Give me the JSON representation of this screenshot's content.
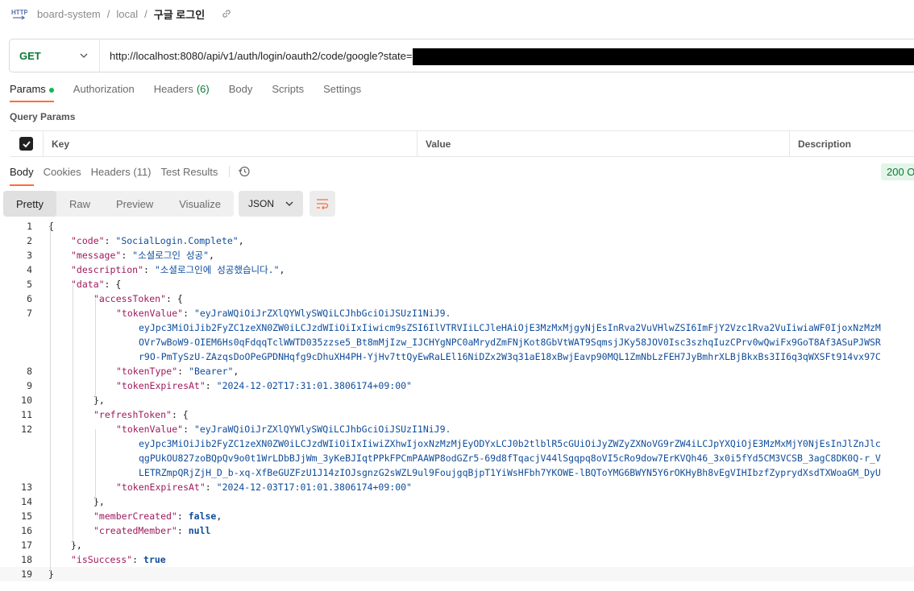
{
  "breadcrumb": {
    "workspace": "board-system",
    "env": "local",
    "current": "구글 로그인"
  },
  "request": {
    "method": "GET",
    "url": "http://localhost:8080/api/v1/auth/login/oauth2/code/google?state="
  },
  "req_tabs": [
    {
      "label": "Params",
      "dot": true
    },
    {
      "label": "Authorization"
    },
    {
      "label": "Headers",
      "count": "(6)"
    },
    {
      "label": "Body"
    },
    {
      "label": "Scripts"
    },
    {
      "label": "Settings"
    }
  ],
  "query_params": {
    "title": "Query Params",
    "headers": [
      "Key",
      "Value",
      "Description"
    ]
  },
  "resp_tabs": [
    "Body",
    "Cookies",
    "Headers (11)",
    "Test Results"
  ],
  "status": "200 O",
  "view_buttons": [
    "Pretty",
    "Raw",
    "Preview",
    "Visualize"
  ],
  "format": "JSON",
  "json_lines": [
    {
      "n": "1",
      "i": 0,
      "t": [
        [
          "p",
          "{"
        ]
      ]
    },
    {
      "n": "2",
      "i": 1,
      "t": [
        [
          "k",
          "\"code\""
        ],
        [
          "p",
          ": "
        ],
        [
          "s",
          "\"SocialLogin.Complete\""
        ],
        [
          "p",
          ","
        ]
      ]
    },
    {
      "n": "3",
      "i": 1,
      "t": [
        [
          "k",
          "\"message\""
        ],
        [
          "p",
          ": "
        ],
        [
          "s",
          "\"소셜로그인 성공\""
        ],
        [
          "p",
          ","
        ]
      ]
    },
    {
      "n": "4",
      "i": 1,
      "t": [
        [
          "k",
          "\"description\""
        ],
        [
          "p",
          ": "
        ],
        [
          "s",
          "\"소셜로그인에 성공했습니다.\""
        ],
        [
          "p",
          ","
        ]
      ]
    },
    {
      "n": "5",
      "i": 1,
      "t": [
        [
          "k",
          "\"data\""
        ],
        [
          "p",
          ": {"
        ]
      ]
    },
    {
      "n": "6",
      "i": 2,
      "t": [
        [
          "k",
          "\"accessToken\""
        ],
        [
          "p",
          ": {"
        ]
      ]
    },
    {
      "n": "7",
      "i": 3,
      "t": [
        [
          "k",
          "\"tokenValue\""
        ],
        [
          "p",
          ": "
        ],
        [
          "s",
          "\"eyJraWQiOiJrZXlQYWlySWQiLCJhbGciOiJSUzI1NiJ9."
        ]
      ]
    },
    {
      "n": "",
      "i": 4,
      "t": [
        [
          "s",
          "eyJpc3MiOiJib2FyZC1zeXN0ZW0iLCJzdWIiOiIxIiwicm9sZSI6IlVTRVIiLCJleHAiOjE3MzMxMjgyNjEsInRva2VuVHlwZSI6ImFjY2Vzc1Rva2VuIiwiaWF0IjoxNzMzM"
        ]
      ]
    },
    {
      "n": "",
      "i": 4,
      "t": [
        [
          "s",
          "OVr7wBoW9-OIEM6Hs0qFdqqTclWWTD035zzse5_Bt8mMjIzw_IJCHYgNPC0aMrydZmFNjKot8GbVtWAT9SqmsjJKy58JOV0Isc3szhqIuzCPrv0wQwiFx9GoT8Af3ASuPJWSR"
        ]
      ]
    },
    {
      "n": "",
      "i": 4,
      "t": [
        [
          "s",
          "r9O-PmTySzU-ZAzqsDoOPeGPDNHqfg9cDhuXH4PH-YjHv7ttQyEwRaLEl16NiDZx2W3q31aE18xBwjEavp90MQL1ZmNbLzFEH7JyBmhrXLBjBkxBs3II6q3qWXSFt914vx97C"
        ]
      ]
    },
    {
      "n": "8",
      "i": 3,
      "t": [
        [
          "k",
          "\"tokenType\""
        ],
        [
          "p",
          ": "
        ],
        [
          "s",
          "\"Bearer\""
        ],
        [
          "p",
          ","
        ]
      ]
    },
    {
      "n": "9",
      "i": 3,
      "t": [
        [
          "k",
          "\"tokenExpiresAt\""
        ],
        [
          "p",
          ": "
        ],
        [
          "s",
          "\"2024-12-02T17:31:01.3806174+09:00\""
        ]
      ]
    },
    {
      "n": "10",
      "i": 2,
      "t": [
        [
          "p",
          "},"
        ]
      ]
    },
    {
      "n": "11",
      "i": 2,
      "t": [
        [
          "k",
          "\"refreshToken\""
        ],
        [
          "p",
          ": {"
        ]
      ]
    },
    {
      "n": "12",
      "i": 3,
      "t": [
        [
          "k",
          "\"tokenValue\""
        ],
        [
          "p",
          ": "
        ],
        [
          "s",
          "\"eyJraWQiOiJrZXlQYWlySWQiLCJhbGciOiJSUzI1NiJ9."
        ]
      ]
    },
    {
      "n": "",
      "i": 4,
      "t": [
        [
          "s",
          "eyJpc3MiOiJib2FyZC1zeXN0ZW0iLCJzdWIiOiIxIiwiZXhwIjoxNzMzMjEyODYxLCJ0b2tlblR5cGUiOiJyZWZyZXNoVG9rZW4iLCJpYXQiOjE3MzMxMjY0NjEsInJlZnJlc"
        ]
      ]
    },
    {
      "n": "",
      "i": 4,
      "t": [
        [
          "s",
          "qgPUkOU827zoBQpQv9o0t1WrLDbBJjWm_3yKeBJIqtPPkFPCmPAAWP8odGZr5-69d8fTqacjV44lSgqpq8oVI5cRo9dow7ErKVQh46_3x0i5fYd5CM3VCSB_3agC8DK0Q-r_V"
        ]
      ]
    },
    {
      "n": "",
      "i": 4,
      "t": [
        [
          "s",
          "LETRZmpQRjZjH_D_b-xq-XfBeGUZFzU1J14zIOJsgnzG2sWZL9ul9FoujgqBjpT1YiWsHFbh7YKOWE-lBQToYMG6BWYN5Y6rOKHyBh8vEgVIHIbzfZyprydXsdTXWoaGM_DyU"
        ]
      ]
    },
    {
      "n": "13",
      "i": 3,
      "t": [
        [
          "k",
          "\"tokenExpiresAt\""
        ],
        [
          "p",
          ": "
        ],
        [
          "s",
          "\"2024-12-03T17:01:01.3806174+09:00\""
        ]
      ]
    },
    {
      "n": "14",
      "i": 2,
      "t": [
        [
          "p",
          "},"
        ]
      ]
    },
    {
      "n": "15",
      "i": 2,
      "t": [
        [
          "k",
          "\"memberCreated\""
        ],
        [
          "p",
          ": "
        ],
        [
          "b",
          "false"
        ],
        [
          "p",
          ","
        ]
      ]
    },
    {
      "n": "16",
      "i": 2,
      "t": [
        [
          "k",
          "\"createdMember\""
        ],
        [
          "p",
          ": "
        ],
        [
          "b",
          "null"
        ]
      ]
    },
    {
      "n": "17",
      "i": 1,
      "t": [
        [
          "p",
          "},"
        ]
      ]
    },
    {
      "n": "18",
      "i": 1,
      "t": [
        [
          "k",
          "\"isSuccess\""
        ],
        [
          "p",
          ": "
        ],
        [
          "b",
          "true"
        ]
      ]
    },
    {
      "n": "19",
      "i": 0,
      "t": [
        [
          "p",
          "}"
        ]
      ]
    }
  ],
  "colors": {
    "accent": "#ff6c37",
    "get": "#0b7a38",
    "json_key": "#a0195e",
    "json_string": "#0e4c9b"
  }
}
